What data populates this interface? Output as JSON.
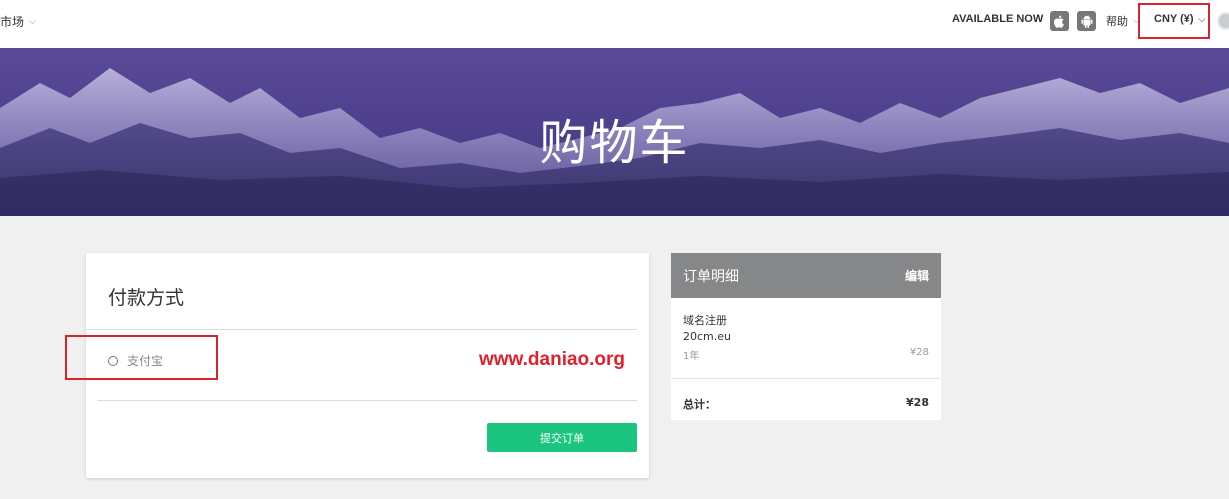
{
  "topbar": {
    "market_label": "市场",
    "available_label": "AVAILABLE NOW",
    "apple_icon": "apple-icon",
    "android_icon": "android-icon",
    "help_label": "帮助",
    "currency_label": "CNY (¥)"
  },
  "hero": {
    "title": "购物车"
  },
  "payment": {
    "title": "付款方式",
    "options": [
      {
        "label": "支付宝",
        "selected": false
      }
    ],
    "watermark": "www.daniao.org",
    "submit_label": "提交订单"
  },
  "order": {
    "title": "订单明细",
    "edit_label": "编辑",
    "items": [
      {
        "type": "域名注册",
        "domain": "20cm.eu",
        "period": "1年",
        "price": "¥28"
      }
    ],
    "total_label": "总计：",
    "total_value": "¥28"
  },
  "colors": {
    "accent_green": "#1cc57f",
    "highlight_red": "#d9232d",
    "hero_purple": "#4d3f8c"
  }
}
